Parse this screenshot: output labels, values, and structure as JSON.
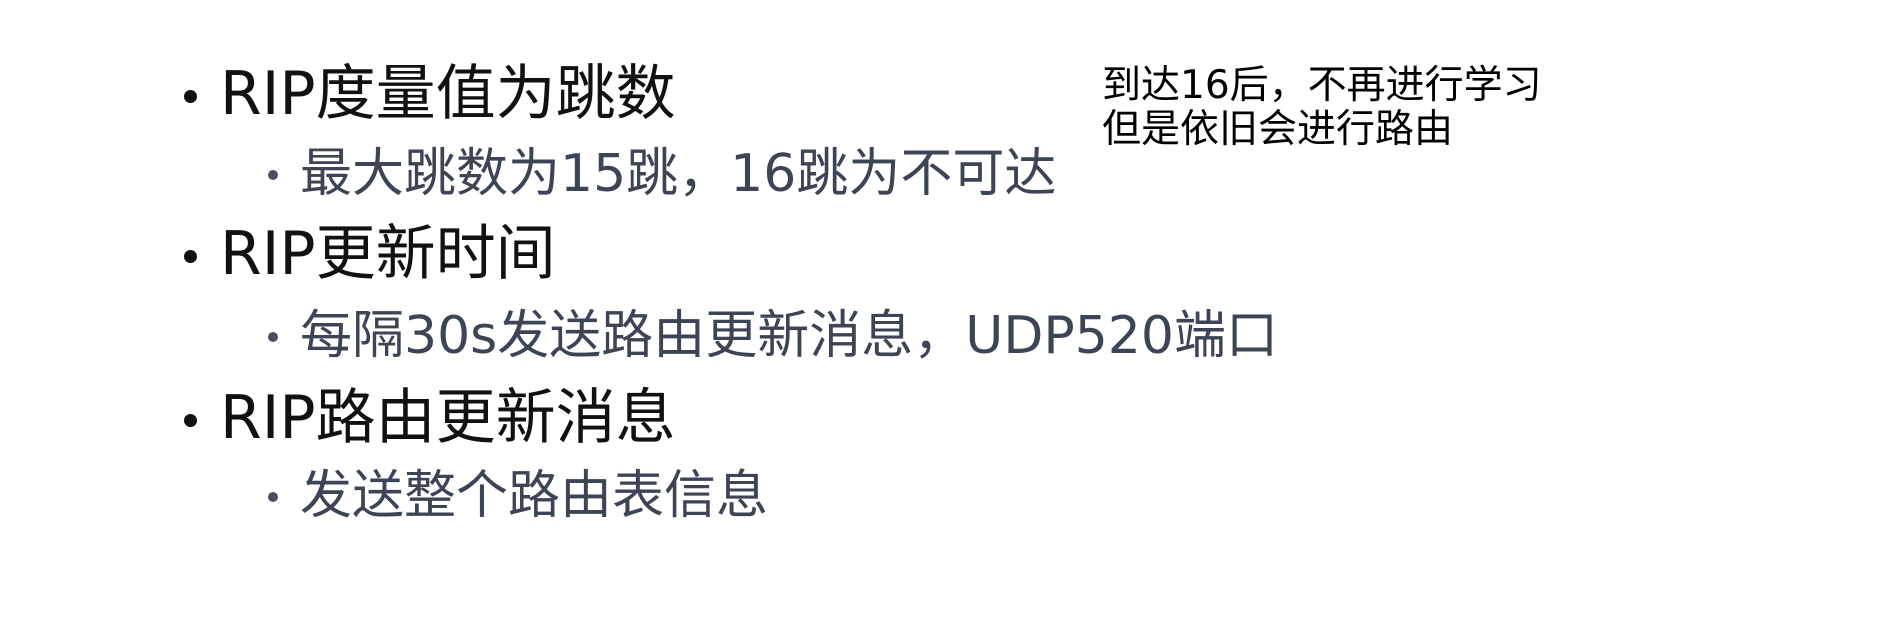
{
  "bullets": [
    {
      "text": "RIP度量值为跳数",
      "sub": "最大跳数为15跳，16跳为不可达"
    },
    {
      "text": "RIP更新时间",
      "sub": "每隔30s发送路由更新消息，UDP520端口"
    },
    {
      "text": "RIP路由更新消息",
      "sub": "发送整个路由表信息"
    }
  ],
  "annotation": {
    "line1": "到达16后，不再进行学习",
    "line2": "但是依旧会进行路由"
  }
}
